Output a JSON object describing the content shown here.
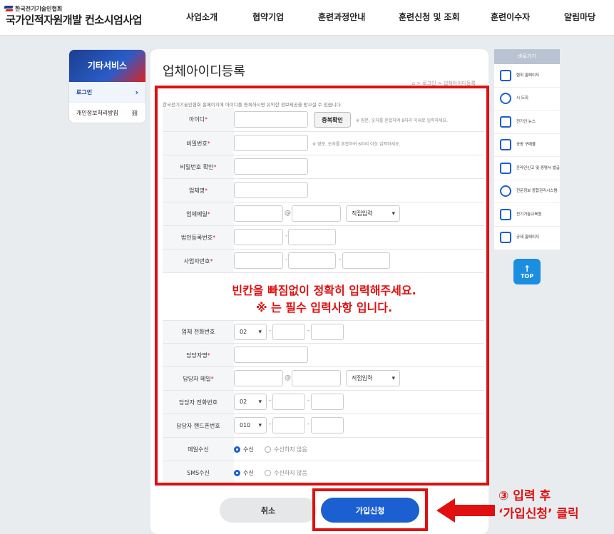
{
  "header": {
    "logo_small": "한국전기기술인협회",
    "logo_big": "국가인적자원개발 컨소시엄사업",
    "nav": [
      "사업소개",
      "협약기업",
      "훈련과정안내",
      "훈련신청 및 조회",
      "훈련이수자",
      "알림마당"
    ]
  },
  "sidebar": {
    "title": "기타서비스",
    "items": [
      {
        "label": "로그인",
        "icon": "chevron-right-icon"
      },
      {
        "label": "개인정보처리방침",
        "icon": "link-icon"
      }
    ]
  },
  "main": {
    "title": "업체아이디등록",
    "breadcrumb": "⌂ > 로그인 > 업체아이디등록",
    "intro": "한국전기기술인협회 홈페이지에 아이디를 등록하시면 유익한 정보제공을 받으실 수 있습니다."
  },
  "form": {
    "id_label": "아이디",
    "id_check_button": "중복확인",
    "id_hint": "※ 영문, 숫자를 혼합하여 8자리 이내로 입력하세요.",
    "pw_label": "비밀번호",
    "pw_hint": "※ 영문, 숫자를 혼합하여 6자리 이상 입력하세요.",
    "pw_confirm_label": "비밀번호 확인",
    "company_name_label": "업체명",
    "company_email_label": "업체메일",
    "email_at": "@",
    "email_domain_select": "직접입력",
    "corp_number_label": "법인등록번호",
    "biz_number_label": "사업자번호",
    "company_phone_label": "업체 전화번호",
    "area_code": "02",
    "manager_name_label": "담당자명",
    "manager_email_label": "담당자 메일",
    "manager_phone_label": "담당자 전화번호",
    "manager_mobile_label": "담당자 핸드폰번호",
    "mobile_prefix": "010",
    "email_receive_label": "메일수신",
    "sms_receive_label": "SMS수신",
    "receive_yes": "수신",
    "receive_no": "수신하지 않음",
    "required_mark": "*",
    "dash": "-"
  },
  "overlay": {
    "line1": "빈칸을 빠짐없이 정확히 입력해주세요.",
    "line2": "※ 는 필수 입력사항 입니다."
  },
  "buttons": {
    "cancel": "취소",
    "submit": "가입신청"
  },
  "callout": {
    "line1": "③ 입력 후",
    "line2": "‘가입신청’ 클릭"
  },
  "quick": {
    "title": "바로가기",
    "items": [
      "협회 홈페이지",
      "시·도회",
      "전기인 뉴스",
      "공동 구매몰",
      "온라인신고 및 증명서 발급",
      "전문정보 종합관리시스템",
      "전기기술교육원",
      "공제 홈페이지"
    ],
    "top": "TOP"
  },
  "colors": {
    "accent": "#1b5fd1",
    "annotation": "#e01010",
    "brand_navy": "#1b3f8f"
  }
}
